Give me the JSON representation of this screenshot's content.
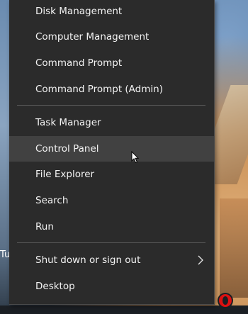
{
  "left_label": "Tu",
  "menu": {
    "items": [
      {
        "id": "disk-management",
        "label": "Disk Management",
        "top": 0
      },
      {
        "id": "computer-management",
        "label": "Computer Management"
      },
      {
        "id": "command-prompt",
        "label": "Command Prompt"
      },
      {
        "id": "command-prompt-admin",
        "label": "Command Prompt (Admin)"
      },
      {
        "id": "task-manager",
        "label": "Task Manager"
      },
      {
        "id": "control-panel",
        "label": "Control Panel",
        "hovered": true
      },
      {
        "id": "file-explorer",
        "label": "File Explorer"
      },
      {
        "id": "search",
        "label": "Search"
      },
      {
        "id": "run",
        "label": "Run"
      },
      {
        "id": "shut-down-or-sign-out",
        "label": "Shut down or sign out",
        "has_submenu": true
      },
      {
        "id": "desktop",
        "label": "Desktop"
      }
    ]
  },
  "icons": {
    "submenu": "chevron-right-icon",
    "cursor": "mouse-pointer-icon"
  },
  "colors": {
    "menu_bg": "#2b2b2b",
    "hover_bg": "#414141",
    "text": "#f2f2f2",
    "separator": "#5a5a5a"
  }
}
